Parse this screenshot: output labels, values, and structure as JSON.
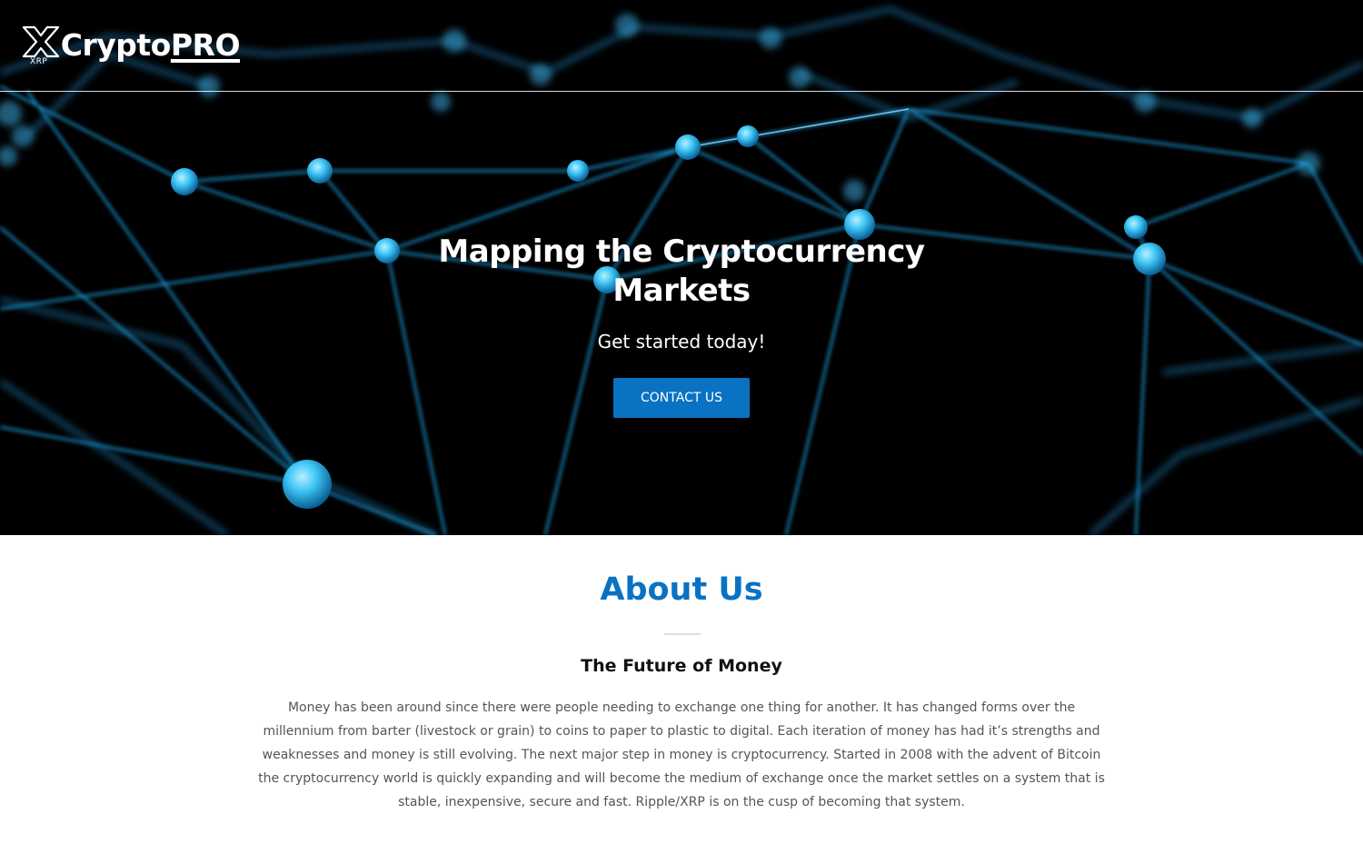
{
  "brand": {
    "logo_sub": "XRP",
    "name_main": "Crypto",
    "name_accent": "PRO"
  },
  "hero": {
    "title_line1": "Mapping the Cryptocurrency",
    "title_line2": "Markets",
    "subtitle": "Get started today!",
    "cta_label": "CONTACT US"
  },
  "about": {
    "title": "About Us",
    "subtitle": "The Future of Money",
    "body": "Money has been around since there were people needing to exchange one thing for another. It has changed forms over the millennium from barter (livestock or grain) to coins to paper to plastic to digital. Each iteration of money has had it’s strengths and weaknesses and money is still evolving. The next major step in money is cryptocurrency. Started in 2008 with the advent of Bitcoin the cryptocurrency world is quickly expanding and will become the medium of exchange once the market settles on a system that is stable, inexpensive, secure and fast. Ripple/XRP is on the cusp of becoming that system."
  },
  "colors": {
    "accent": "#0a72c2",
    "network_line": "#1e9ad8",
    "network_node": "#3ec5f5",
    "hero_background": "#000000"
  },
  "icons": {
    "logo_mark": "xrp-logo-icon"
  }
}
